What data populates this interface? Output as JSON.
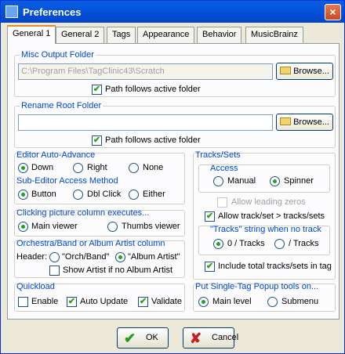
{
  "window": {
    "title": "Preferences",
    "close_glyph": "×"
  },
  "tabs": [
    "General 1",
    "General 2",
    "Tags",
    "Appearance",
    "Behavior",
    "MusicBrainz"
  ],
  "misc_output": {
    "title": "Misc Output Folder",
    "path": "C:\\Program Files\\TagClinic43\\Scratch",
    "browse": "Browse...",
    "follows": "Path follows active folder",
    "follows_checked": true
  },
  "rename_root": {
    "title": "Rename Root Folder",
    "path": "",
    "browse": "Browse...",
    "follows": "Path follows active folder",
    "follows_checked": true
  },
  "editor_auto_advance": {
    "title": "Editor Auto-Advance",
    "options": [
      "Down",
      "Right",
      "None"
    ],
    "selected": "Down"
  },
  "sub_editor": {
    "title": "Sub-Editor Access Method",
    "options": [
      "Button",
      "Dbl Click",
      "Either"
    ],
    "selected": "Button"
  },
  "picture_column": {
    "title": "Clicking picture column executes...",
    "options": [
      "Main viewer",
      "Thumbs viewer"
    ],
    "selected": "Main viewer"
  },
  "orchestra": {
    "title": "Orchestra/Band or Album Artist column",
    "header_label": "Header:",
    "options": [
      "\"Orch/Band\"",
      "\"Album Artist\""
    ],
    "selected": "\"Album Artist\"",
    "show_artist": "Show Artist if no Album Artist",
    "show_artist_checked": false
  },
  "quickload": {
    "title": "Quickload",
    "enable": "Enable",
    "enable_checked": false,
    "auto_update": "Auto Update",
    "auto_update_checked": true,
    "validate": "Validate",
    "validate_checked": true
  },
  "tracks_sets": {
    "title": "Tracks/Sets",
    "access_title": "Access",
    "access_options": [
      "Manual",
      "Spinner"
    ],
    "access_selected": "Spinner",
    "allow_leading_zeros": "Allow leading zeros",
    "allow_leading_zeros_checked": false,
    "allow_track_gt": "Allow track/set > tracks/sets",
    "allow_track_gt_checked": true,
    "tracks_string_title": "\"Tracks\" string when no track",
    "tracks_string_options": [
      "0 / Tracks",
      "/ Tracks"
    ],
    "tracks_string_selected": "0 / Tracks",
    "include_total": "Include total tracks/sets in tag",
    "include_total_checked": true
  },
  "single_tag_popup": {
    "title": "Put Single-Tag Popup tools on...",
    "options": [
      "Main level",
      "Submenu"
    ],
    "selected": "Main level"
  },
  "footer": {
    "ok": "OK",
    "cancel": "Cancel",
    "ok_icon": "✔",
    "cancel_icon": "✘"
  },
  "check_glyph": "✔"
}
